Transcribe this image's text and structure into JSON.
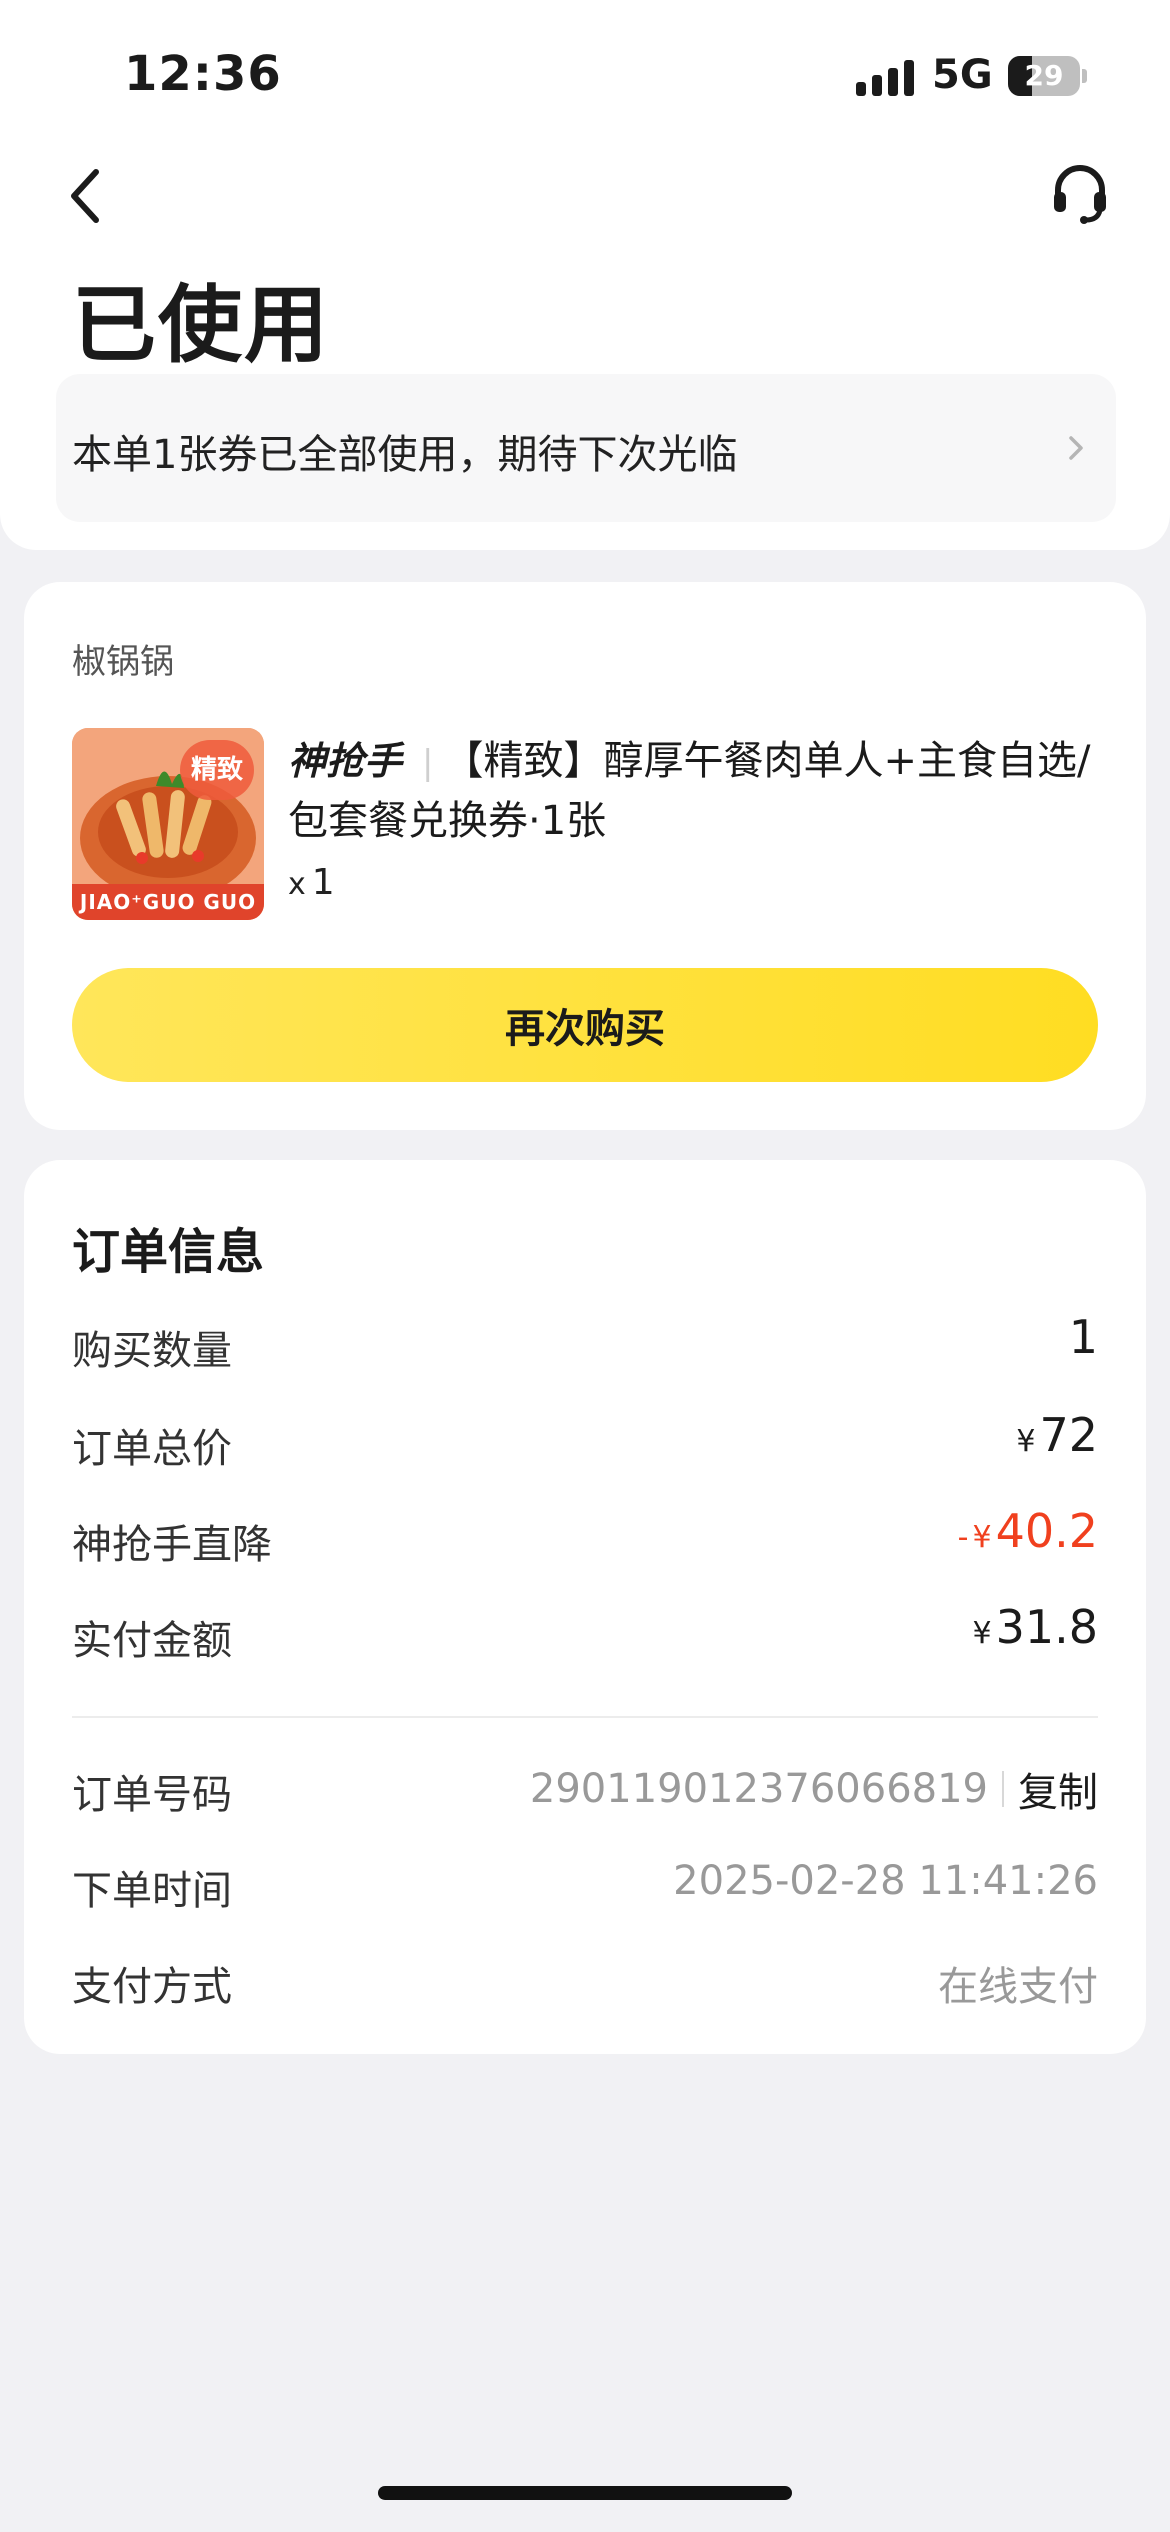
{
  "status_bar": {
    "time": "12:36",
    "network": "5G",
    "battery": "29"
  },
  "header": {
    "title": "已使用"
  },
  "notice": {
    "text": "本单1张券已全部使用，期待下次光临"
  },
  "product": {
    "shop_name": "椒锅锅",
    "thumb_badge": "精致",
    "thumb_brand": "JIAO⁺GUO GUO",
    "brand_tag": "神抢手",
    "title": "【精致】醇厚午餐肉单人+主食自选/包套餐兑换券·1张",
    "quantity_prefix": "x",
    "quantity": "1",
    "buy_again_label": "再次购买"
  },
  "order_info": {
    "heading": "订单信息",
    "currency": "¥",
    "rows": [
      {
        "label": "购买数量",
        "value": "1"
      },
      {
        "label": "订单总价",
        "value": "72"
      },
      {
        "label": "神抢手直降",
        "prefix": "-",
        "value": "40.2"
      },
      {
        "label": "实付金额",
        "value": "31.8"
      }
    ],
    "order_no": {
      "label": "订单号码",
      "value": "290119012376066819",
      "copy_label": "复制"
    },
    "order_time": {
      "label": "下单时间",
      "value": "2025-02-28 11:41:26"
    },
    "payment": {
      "label": "支付方式",
      "value": "在线支付"
    }
  },
  "colors": {
    "accent_yellow": "#ffdf2b",
    "discount_red": "#f0401e",
    "background": "#f1f1f4"
  }
}
